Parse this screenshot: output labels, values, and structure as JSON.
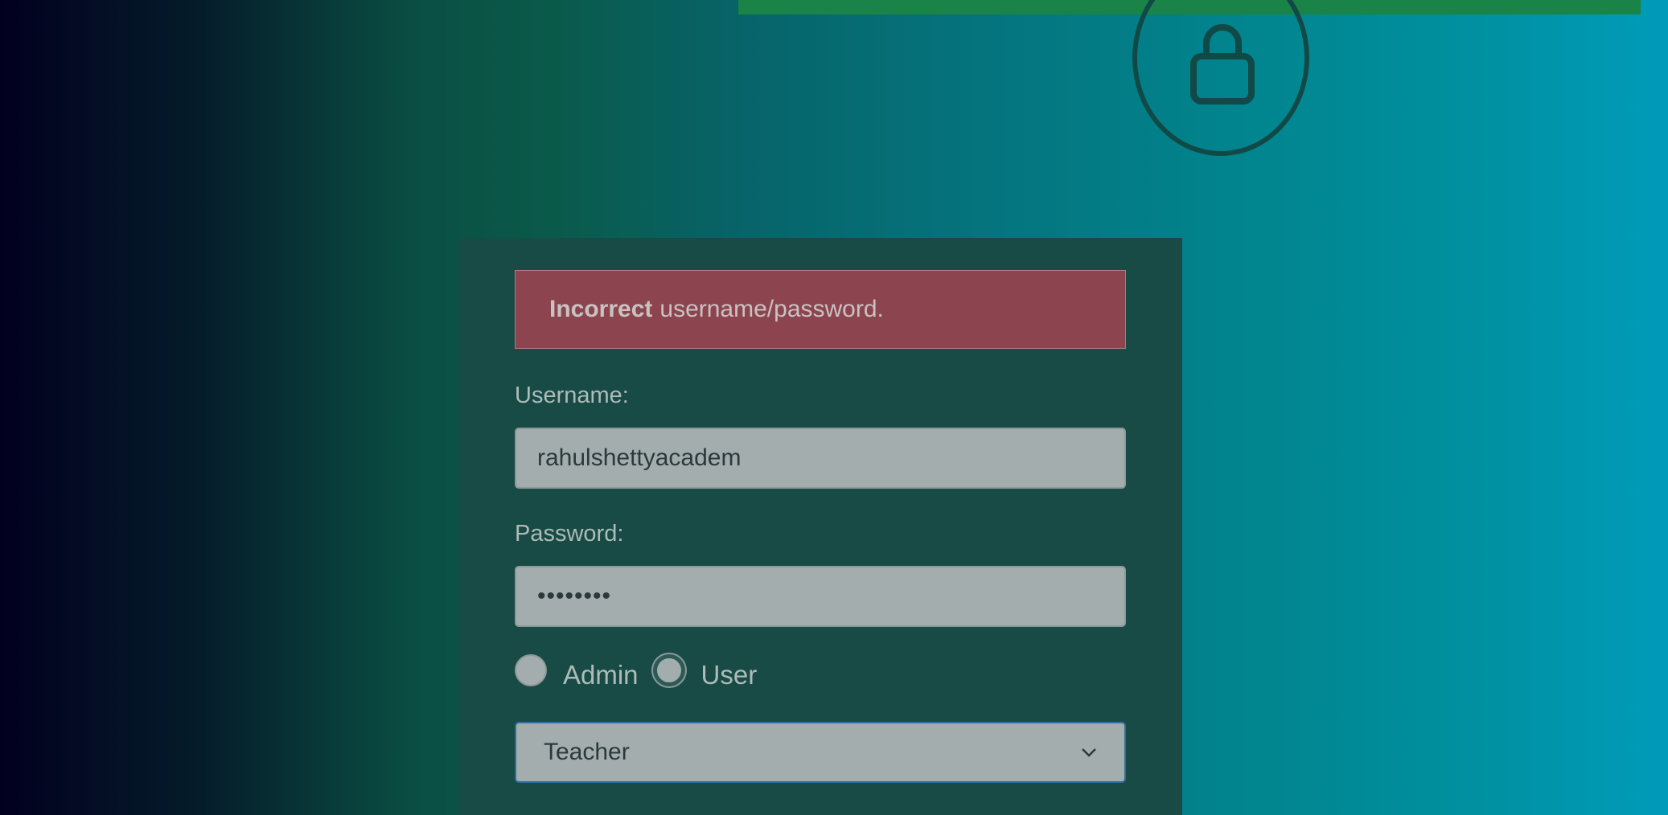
{
  "alert": {
    "strong": "Incorrect",
    "message": "username/password."
  },
  "username": {
    "label": "Username:",
    "value": "rahulshettyacadem"
  },
  "password": {
    "label": "Password:",
    "value": "••••••••"
  },
  "role_radios": [
    {
      "label": "Admin",
      "selected": false
    },
    {
      "label": "User",
      "selected": false
    }
  ],
  "user_type_select": {
    "selected": "Teacher"
  },
  "colors": {
    "alert_bg": "#8c444e",
    "panel_bg": "#184a46",
    "top_bar": "#1a8347",
    "input_bg": "#a4adad"
  },
  "icons": {
    "lock": "lock-icon",
    "select_arrow": "chevron-down-icon"
  }
}
